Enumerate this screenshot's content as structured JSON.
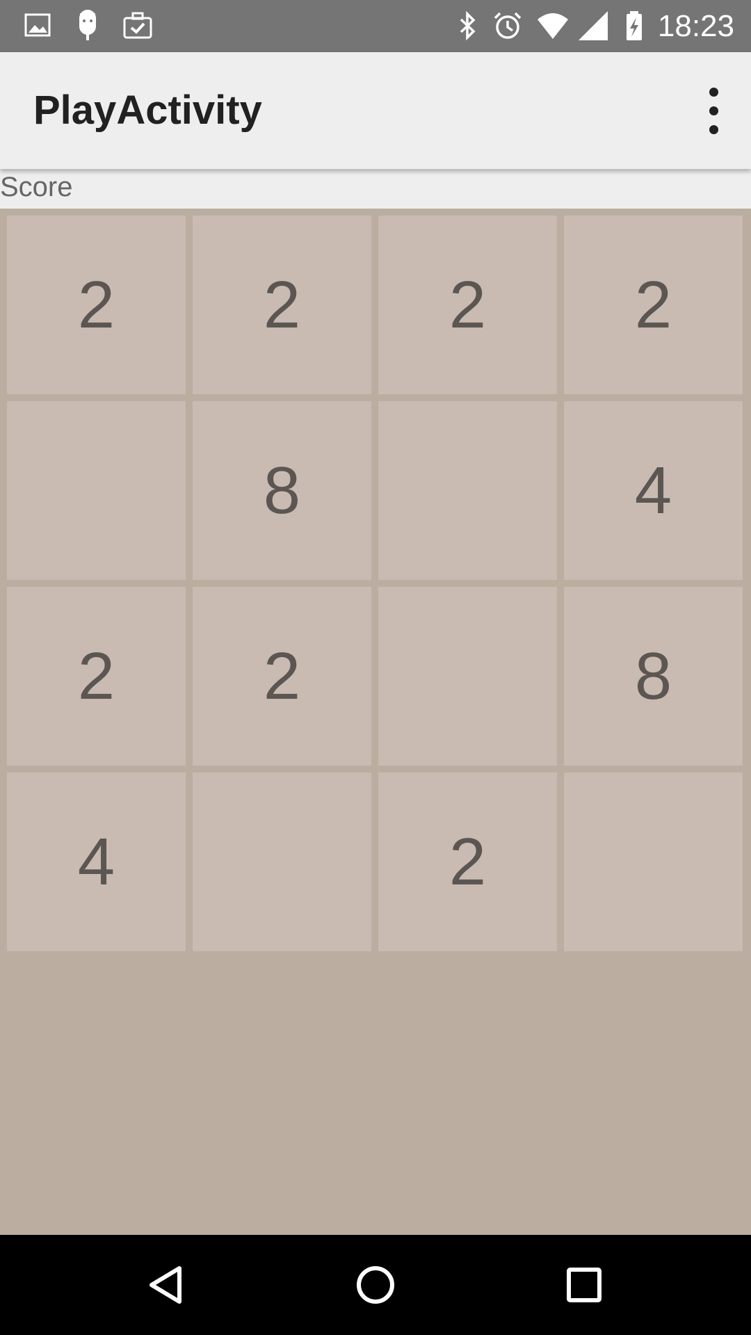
{
  "status_bar": {
    "time": "18:23",
    "left_icons": [
      "image-icon",
      "android-debug-icon",
      "task-check-icon"
    ],
    "right_icons": [
      "bluetooth-icon",
      "alarm-icon",
      "wifi-icon",
      "cell-signal-icon",
      "battery-charging-icon"
    ]
  },
  "app_bar": {
    "title": "PlayActivity",
    "overflow_icon": "more-vert-icon"
  },
  "score": {
    "label": "Score"
  },
  "board": {
    "rows": [
      [
        "2",
        "2",
        "2",
        "2"
      ],
      [
        "",
        "8",
        "",
        "4"
      ],
      [
        "2",
        "2",
        "",
        "8"
      ],
      [
        "4",
        "",
        "2",
        ""
      ]
    ]
  },
  "nav_bar": {
    "icons": [
      "back-icon",
      "home-icon",
      "recents-icon"
    ]
  },
  "colors": {
    "status_bar": "#757575",
    "app_bar": "#eeeeee",
    "board_background": "#bbada0",
    "tile": "#c9bbb2",
    "tile_text": "#5c5653"
  }
}
